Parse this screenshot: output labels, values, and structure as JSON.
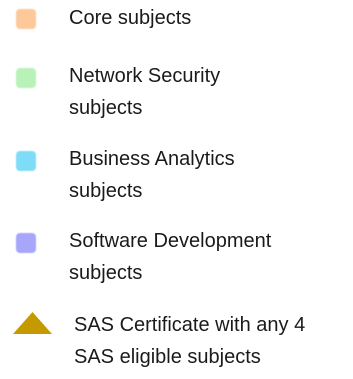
{
  "legend": {
    "items": [
      {
        "label_lines": [
          "Core subjects"
        ],
        "color": "#fdc89a",
        "marker": "square-swatch"
      },
      {
        "label_lines": [
          "Network Security",
          "subjects"
        ],
        "color": "#b9f2b9",
        "marker": "square-swatch"
      },
      {
        "label_lines": [
          "Business Analytics",
          "subjects"
        ],
        "color": "#7fdcf7",
        "marker": "square-swatch"
      },
      {
        "label_lines": [
          "Software Development",
          "subjects"
        ],
        "color": "#a7a6fb",
        "marker": "square-swatch"
      },
      {
        "label_lines": [
          "SAS Certificate with any 4",
          "SAS eligible subjects"
        ],
        "color": "#c49a00",
        "marker": "triangle"
      }
    ]
  }
}
